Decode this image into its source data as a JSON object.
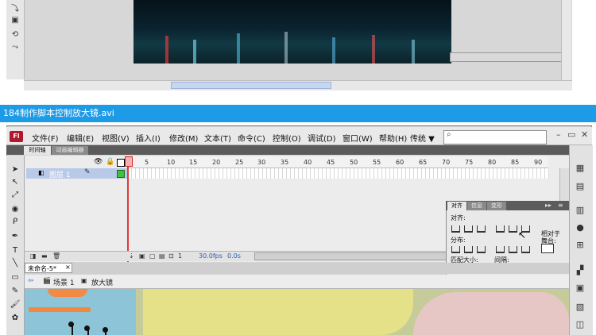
{
  "video_title": "184制作脚本控制放大镜.avi",
  "menu": {
    "items": [
      "文件(F)",
      "编辑(E)",
      "视图(V)",
      "插入(I)",
      "修改(M)",
      "文本(T)",
      "命令(C)",
      "控制(O)",
      "调试(D)",
      "窗口(W)",
      "帮助(H)"
    ],
    "workspace": "传统 ▼",
    "search_placeholder": ""
  },
  "timeline": {
    "tabs": [
      "时间轴",
      "动画编辑器"
    ],
    "frame_numbers": [
      "1",
      "5",
      "10",
      "15",
      "20",
      "25",
      "30",
      "35",
      "40",
      "45",
      "50",
      "55",
      "60",
      "65",
      "70",
      "75",
      "80",
      "85",
      "90"
    ],
    "layer_name": "图层 1",
    "current_frame": "1",
    "fps": "30.0fps",
    "time": "0.0s"
  },
  "align_panel": {
    "tabs": [
      "对齐",
      "信息",
      "变形"
    ],
    "align_label": "对齐:",
    "distribute_label": "分布:",
    "match_size_label": "匹配大小:",
    "spacing_label": "间隔:",
    "relative_stage_label_1": "相对于",
    "relative_stage_label_2": "舞台:"
  },
  "document": {
    "tab_name": "未命名-5*",
    "scene": "场景 1",
    "symbol": "放大镜"
  },
  "colors": {
    "title_bar": "#1e9be6",
    "accent_orange": "#f2883e",
    "playhead": "#e03a3a"
  }
}
